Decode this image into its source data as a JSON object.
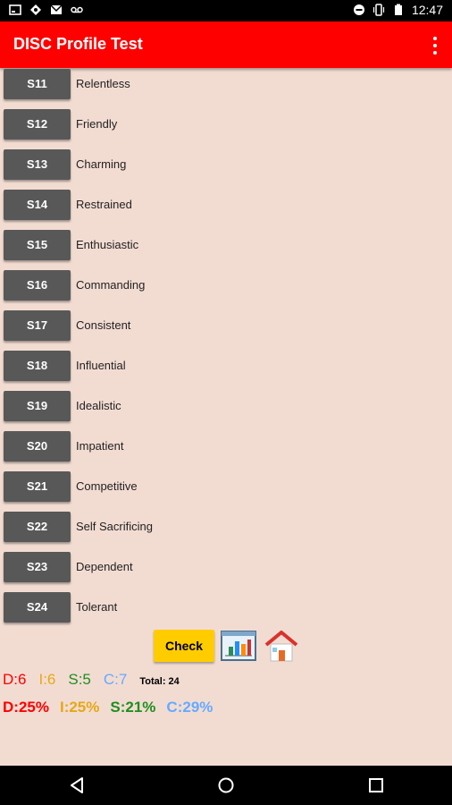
{
  "status_bar": {
    "time": "12:47",
    "left_icons": [
      "screenshot-icon",
      "app-notification-icon",
      "gmail-icon",
      "voicemail-icon"
    ],
    "right_icons": [
      "do-not-disturb-icon",
      "vibrate-icon",
      "battery-icon"
    ]
  },
  "app_bar": {
    "title": "DISC Profile Test",
    "menu_icon": "overflow-menu-icon",
    "color": "#ff0000"
  },
  "rows": [
    {
      "id": "S11",
      "label": "Relentless"
    },
    {
      "id": "S12",
      "label": "Friendly"
    },
    {
      "id": "S13",
      "label": "Charming"
    },
    {
      "id": "S14",
      "label": "Restrained"
    },
    {
      "id": "S15",
      "label": "Enthusiastic"
    },
    {
      "id": "S16",
      "label": "Commanding"
    },
    {
      "id": "S17",
      "label": "Consistent"
    },
    {
      "id": "S18",
      "label": "Influential"
    },
    {
      "id": "S19",
      "label": "Idealistic"
    },
    {
      "id": "S20",
      "label": "Impatient"
    },
    {
      "id": "S21",
      "label": "Competitive"
    },
    {
      "id": "S22",
      "label": "Self Sacrificing"
    },
    {
      "id": "S23",
      "label": "Dependent"
    },
    {
      "id": "S24",
      "label": "Tolerant"
    }
  ],
  "actions": {
    "check_label": "Check",
    "check_color": "#ffcc00",
    "chart_icon": "bar-chart-icon",
    "home_icon": "home-icon"
  },
  "counts": {
    "d": "D:6",
    "i": "I:6",
    "s": "S:5",
    "c": "C:7",
    "total": "Total: 24"
  },
  "percentages": {
    "d": "D:25%",
    "i": "I:25%",
    "s": "S:21%",
    "c": "C:29%"
  },
  "colors": {
    "d": "#ff0000",
    "i": "#e6a817",
    "s": "#1f8f1f",
    "c": "#66aaff",
    "background": "#f2dcd2",
    "row_button": "#585858"
  },
  "nav_bar": {
    "icons": [
      "back-icon",
      "home-nav-icon",
      "recents-icon"
    ]
  }
}
